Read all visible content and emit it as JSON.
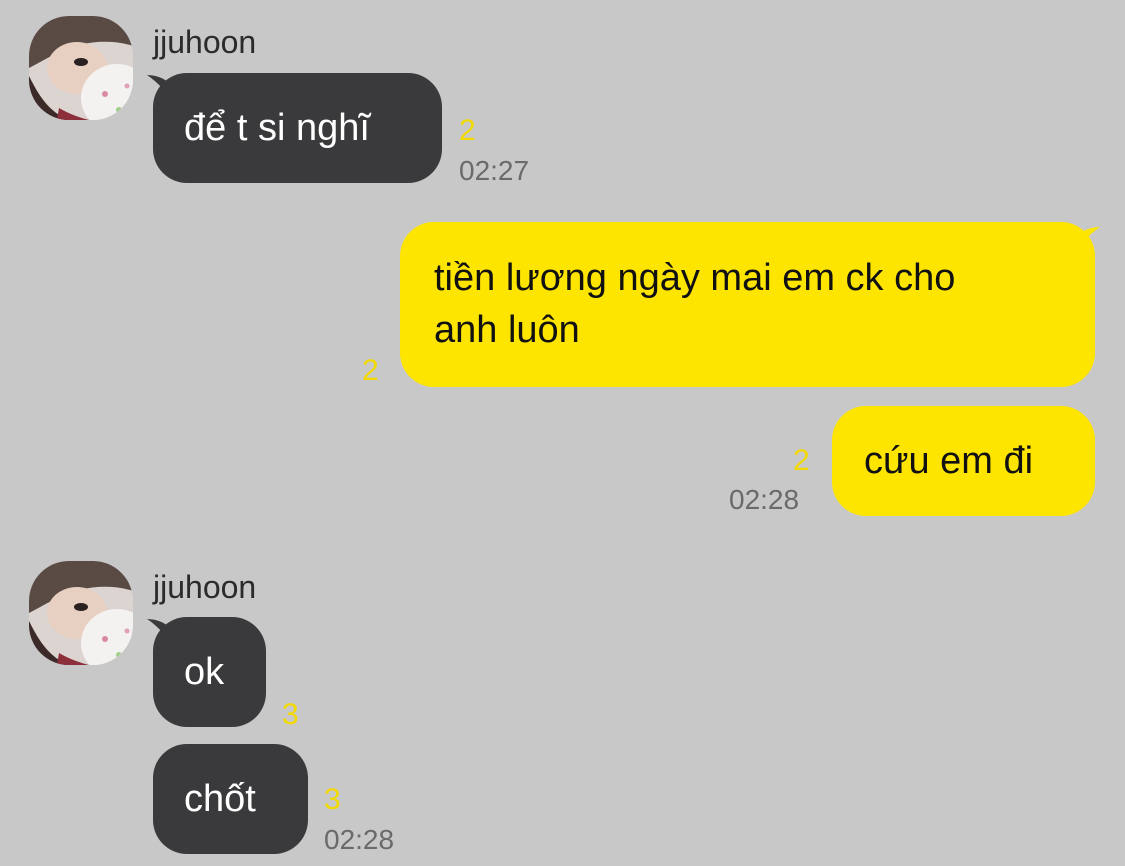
{
  "conversation": {
    "group1": {
      "sender_name": "jjuhoon",
      "avatar_icon": "user-avatar-photo",
      "messages": [
        {
          "text": "để t si nghĩ",
          "unread_count": "2",
          "time": "02:27"
        }
      ]
    },
    "group2": {
      "messages": [
        {
          "line1": "tiền lương ngày mai em ck cho",
          "line2": "anh luôn",
          "unread_count": "2"
        },
        {
          "text": "cứu em đi",
          "unread_count": "2",
          "time": "02:28"
        }
      ]
    },
    "group3": {
      "sender_name": "jjuhoon",
      "avatar_icon": "user-avatar-photo",
      "messages": [
        {
          "text": "ok",
          "unread_count": "3"
        },
        {
          "text": "chốt",
          "unread_count": "3",
          "time": "02:28"
        }
      ]
    }
  },
  "colors": {
    "background": "#c8c8c8",
    "incoming_bubble": "#3a3a3c",
    "outgoing_bubble": "#fee500",
    "unread_count": "#f2d900",
    "timestamp": "#6a6a6a"
  }
}
